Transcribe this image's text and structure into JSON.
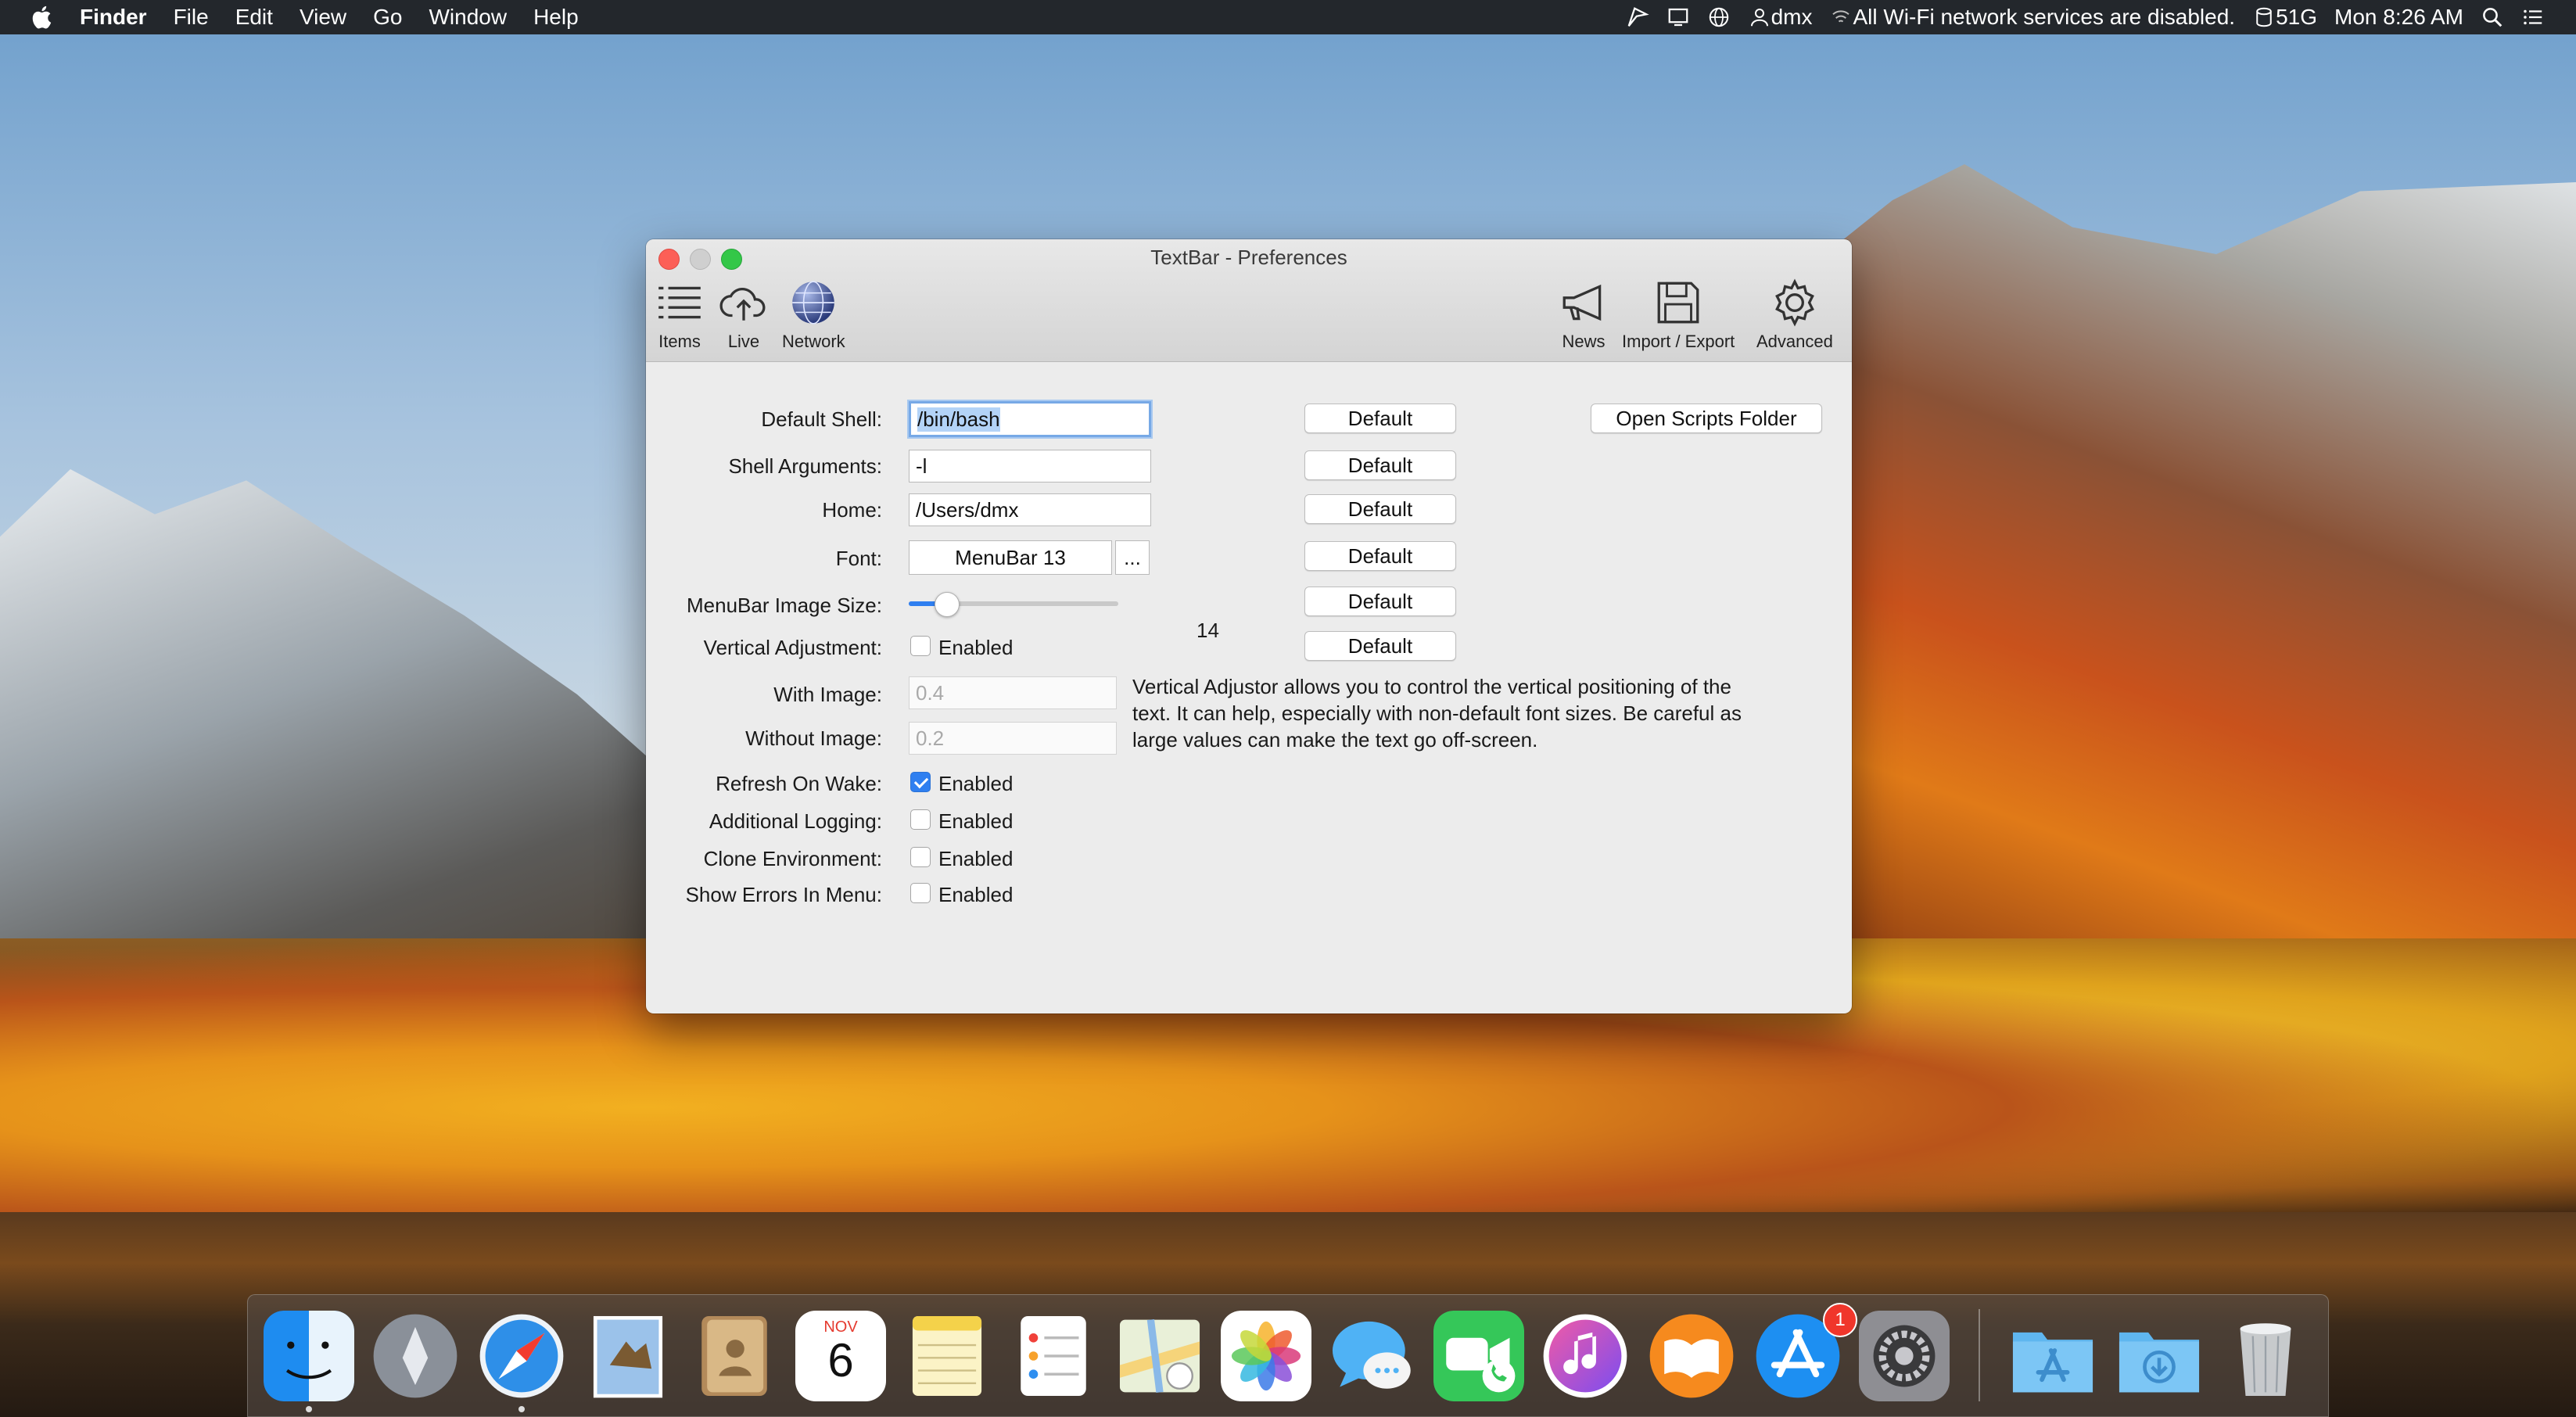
{
  "menubar": {
    "app_name": "Finder",
    "menus": [
      "File",
      "Edit",
      "View",
      "Go",
      "Window",
      "Help"
    ],
    "user": "dmx",
    "wifi_status": "All Wi-Fi network services are disabled.",
    "disk": "51G",
    "clock": "Mon 8:26 AM"
  },
  "window": {
    "title": "TextBar - Preferences",
    "toolbar": {
      "items": "Items",
      "live": "Live",
      "network": "Network",
      "news": "News",
      "import_export": "Import / Export",
      "advanced": "Advanced"
    },
    "labels": {
      "default_shell": "Default Shell:",
      "shell_arguments": "Shell Arguments:",
      "home": "Home:",
      "font": "Font:",
      "menubar_image_size": "MenuBar Image Size:",
      "vertical_adjustment": "Vertical Adjustment:",
      "with_image": "With Image:",
      "without_image": "Without Image:",
      "refresh_on_wake": "Refresh On Wake:",
      "additional_logging": "Additional Logging:",
      "clone_environment": "Clone Environment:",
      "show_errors_in_menu": "Show Errors In Menu:"
    },
    "values": {
      "default_shell": "/bin/bash",
      "shell_arguments": "-l",
      "home": "/Users/dmx",
      "font": "MenuBar 13",
      "font_picker": "...",
      "image_size": "14",
      "image_size_slider_fraction": 0.18,
      "with_image_placeholder": "0.4",
      "without_image_placeholder": "0.2"
    },
    "buttons": {
      "default": "Default",
      "open_scripts_folder": "Open Scripts Folder"
    },
    "checkbox_label": "Enabled",
    "checkboxes": {
      "vertical_adjustment": false,
      "refresh_on_wake": true,
      "additional_logging": false,
      "clone_environment": false,
      "show_errors_in_menu": false
    },
    "help_text": [
      "Vertical Adjustor allows you to control the vertical positioning of the",
      "text. It can help, especially with non-default font sizes. Be careful as",
      "large values can make the text go off-screen."
    ]
  },
  "dock": {
    "calendar_month": "NOV",
    "calendar_day": "6",
    "app_store_badge": "1"
  }
}
